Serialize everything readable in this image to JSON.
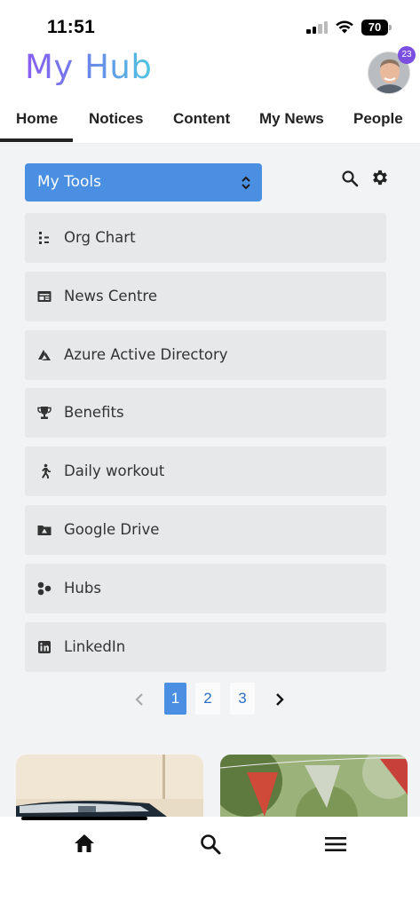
{
  "status_bar": {
    "time": "11:51",
    "battery": "70"
  },
  "header": {
    "title": "My Hub",
    "notification_count": "23"
  },
  "tabs": [
    {
      "label": "Home",
      "active": true
    },
    {
      "label": "Notices"
    },
    {
      "label": "Content"
    },
    {
      "label": "My News"
    },
    {
      "label": "People"
    }
  ],
  "tools": {
    "selected": "My Tools",
    "items": [
      {
        "label": "Org Chart",
        "icon": "org-chart-icon"
      },
      {
        "label": "News Centre",
        "icon": "newspaper-icon"
      },
      {
        "label": "Azure Active Directory",
        "icon": "azure-icon"
      },
      {
        "label": "Benefits",
        "icon": "trophy-icon"
      },
      {
        "label": "Daily workout",
        "icon": "running-icon"
      },
      {
        "label": "Google Drive",
        "icon": "drive-icon"
      },
      {
        "label": "Hubs",
        "icon": "hubs-icon"
      },
      {
        "label": "LinkedIn",
        "icon": "linkedin-icon"
      }
    ]
  },
  "pagination": {
    "pages": [
      "1",
      "2",
      "3"
    ],
    "current": "1"
  },
  "colors": {
    "accent": "#4a8fe2",
    "badge": "#7b4fe0",
    "panel": "#f2f3f4",
    "item": "#e7e8e9"
  }
}
